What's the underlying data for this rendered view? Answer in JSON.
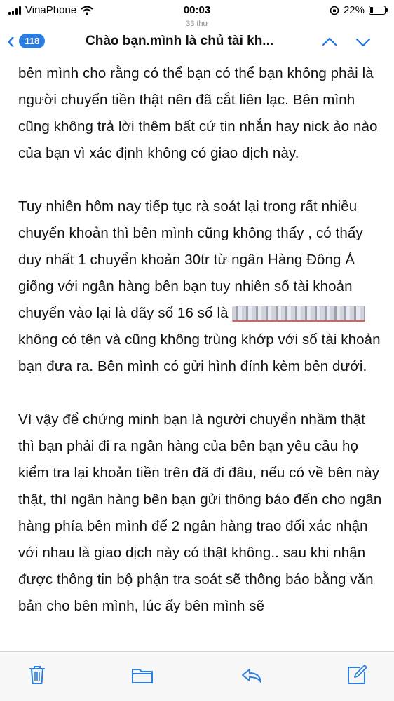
{
  "status": {
    "carrier": "VinaPhone",
    "time": "00:03",
    "battery": "22%",
    "battery_level": 0.22
  },
  "nav": {
    "count": "33 thư",
    "badge": "118",
    "title": "Chào bạn.mình là chủ tài kh..."
  },
  "email": {
    "p1": "bên mình cho rằng có thể bạn có thể bạn không phải là người chuyển tiền thật nên đã cắt liên lạc. Bên mình cũng không trả lời thêm bất cứ tin nhắn hay nick ảo nào của bạn vì xác định không có giao dịch này.",
    "p2_before": "Tuy nhiên hôm nay tiếp tục rà soát lại trong rất nhiều chuyển khoản thì bên mình cũng không thấy , có thấy duy nhất 1 chuyển khoản 30tr từ ngân Hàng Đông Á giống với ngân hàng bên bạn tuy nhiên số tài khoản chuyển vào lại là dãy số 16 số là ",
    "p2_after": " không có tên và cũng không trùng khớp với số tài khoản bạn đưa ra. Bên mình có gửi hình đính kèm bên dưới.",
    "p3": "Vì vậy để chứng minh bạn là người chuyển nhầm thật thì bạn phải đi ra ngân hàng của bên bạn yêu cầu họ kiểm tra lại khoản tiền trên đã đi đâu, nếu có về bên này thật, thì ngân hàng bên bạn gửi thông báo đến cho ngân hàng phía bên mình để 2 ngân hàng trao đổi xác nhận với nhau là giao dịch này có thật không.. sau khi nhận được thông tin bộ phận tra soát sẽ thông báo bằng văn bản cho bên mình, lúc ấy bên mình sẽ"
  },
  "toolbar": {
    "icons": [
      "trash-icon",
      "folder-icon",
      "reply-icon",
      "compose-icon"
    ]
  },
  "colors": {
    "accent": "#1a73e8",
    "badge": "#2a7de1",
    "underline": "#d9433a"
  }
}
